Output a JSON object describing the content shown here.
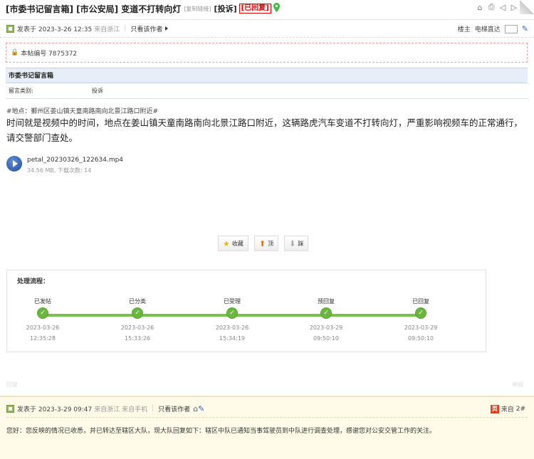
{
  "title": {
    "main": "[市委书记留言箱] [市公安局] 变道不打转向灯",
    "copy_link": "[复制链接]",
    "report": "[投诉]",
    "replied": "[已回复]"
  },
  "post": {
    "posted_label": "发表于 2023-3-26 12:35",
    "from": "来自浙江",
    "only_author": "只看该作者",
    "floor": "楼主",
    "jump_label": "电梯直达"
  },
  "notice": {
    "id_label": "本帖编号 7875372"
  },
  "table": {
    "header": "市委书记留言箱",
    "rows": [
      {
        "key": "留言类别:",
        "value": "投诉"
      }
    ]
  },
  "body": {
    "location": "#地点：鄞州区姜山镇天童南路南向北景江路口附近#",
    "content": "时间就是视频中的时间，地点在姜山镇天童南路南向北景江路口附近，这辆路虎汽车变道不打转向灯，严重影响视频车的正常通行，请交警部门查处。"
  },
  "attachment": {
    "name": "petal_20230326_122634.mp4",
    "meta": "34.56 MB, 下载次数: 14"
  },
  "votes": {
    "favorite": "收藏",
    "up": "顶",
    "down": "踩"
  },
  "process": {
    "title": "处理流程：",
    "steps": [
      {
        "label": "已发帖",
        "date": "2023-03-26",
        "time": "12:35:28"
      },
      {
        "label": "已分类",
        "date": "2023-03-26",
        "time": "15:33:26"
      },
      {
        "label": "已受理",
        "date": "2023-03-26",
        "time": "15:34:19"
      },
      {
        "label": "预回复",
        "date": "2023-03-29",
        "time": "09:50:10"
      },
      {
        "label": "已回复",
        "date": "2023-03-29",
        "time": "09:50:10"
      }
    ]
  },
  "faint": {
    "left": "回复",
    "right": "举报"
  },
  "reply": {
    "posted_label": "发表于 2023-3-29 09:47",
    "from": "来自浙江 来自手机",
    "only_author": "只看该作者",
    "source": "来自",
    "floor": "2#",
    "text": "您好：您反映的情况已收悉，并已转达至辖区大队，现大队回复如下：辖区中队已通知当事驾驶员到中队进行调查处理，感谢您对公安交管工作的关注。"
  },
  "colors": {
    "accent": "#6ab63e",
    "alert": "#e00000",
    "table_head": "#e8eef7",
    "reply_bg": "#fffbe8"
  }
}
